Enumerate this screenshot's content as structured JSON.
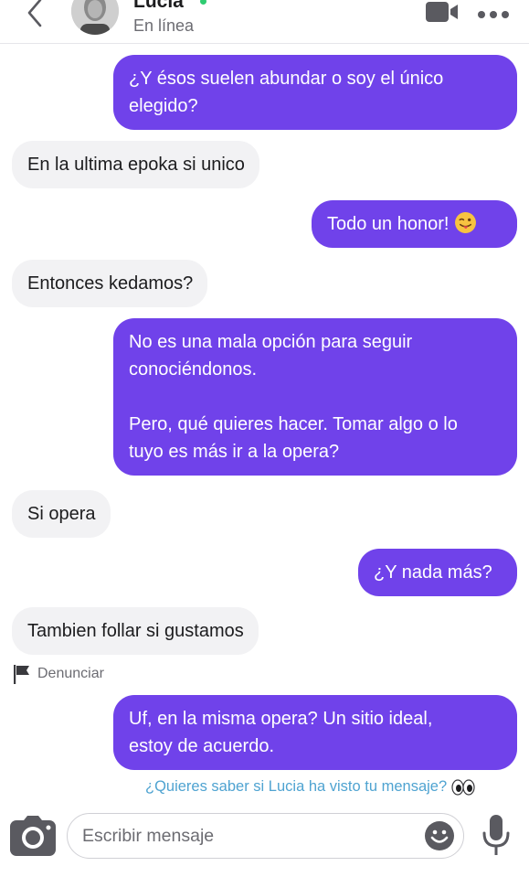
{
  "header": {
    "contact_name": "Lucia",
    "status": "En línea",
    "back_icon": "chevron-left-icon",
    "video_icon": "video-camera-icon",
    "more_icon": "more-dots-icon",
    "online_color": "#2ecc71"
  },
  "messages": [
    {
      "direction": "sent",
      "text": "¿Y ésos suelen abundar o soy el único\nelegido?"
    },
    {
      "direction": "received",
      "text": "En la ultima epoka si unico"
    },
    {
      "direction": "sent",
      "text": "Todo un honor!",
      "emoji": "winking-face-with-tongue"
    },
    {
      "direction": "received",
      "text": "Entonces kedamos?"
    },
    {
      "direction": "sent",
      "text": "No es una mala opción para seguir\nconociéndonos.\n\nPero, qué quieres hacer. Tomar algo o lo\ntuyo es más ir a la opera?"
    },
    {
      "direction": "received",
      "text": "Si opera"
    },
    {
      "direction": "sent",
      "text": "¿Y nada más?"
    },
    {
      "direction": "received",
      "text": "Tambien follar si gustamos"
    },
    {
      "direction": "sent",
      "text": "Uf, en la misma opera? Un sitio ideal,\nestoy de acuerdo."
    }
  ],
  "report": {
    "label": "Denunciar",
    "icon": "flag-icon"
  },
  "read_receipt": {
    "text": "¿Quieres saber si Lucia ha visto tu mensaje?",
    "icon": "eyes-icon"
  },
  "composer": {
    "placeholder": "Escribir mensaje",
    "value": "",
    "camera_icon": "camera-icon",
    "emoji_icon": "smiley-icon",
    "mic_icon": "microphone-icon"
  },
  "colors": {
    "sent_bubble": "#7042ea",
    "received_bubble": "#f2f2f4",
    "link": "#4fa3d1"
  }
}
